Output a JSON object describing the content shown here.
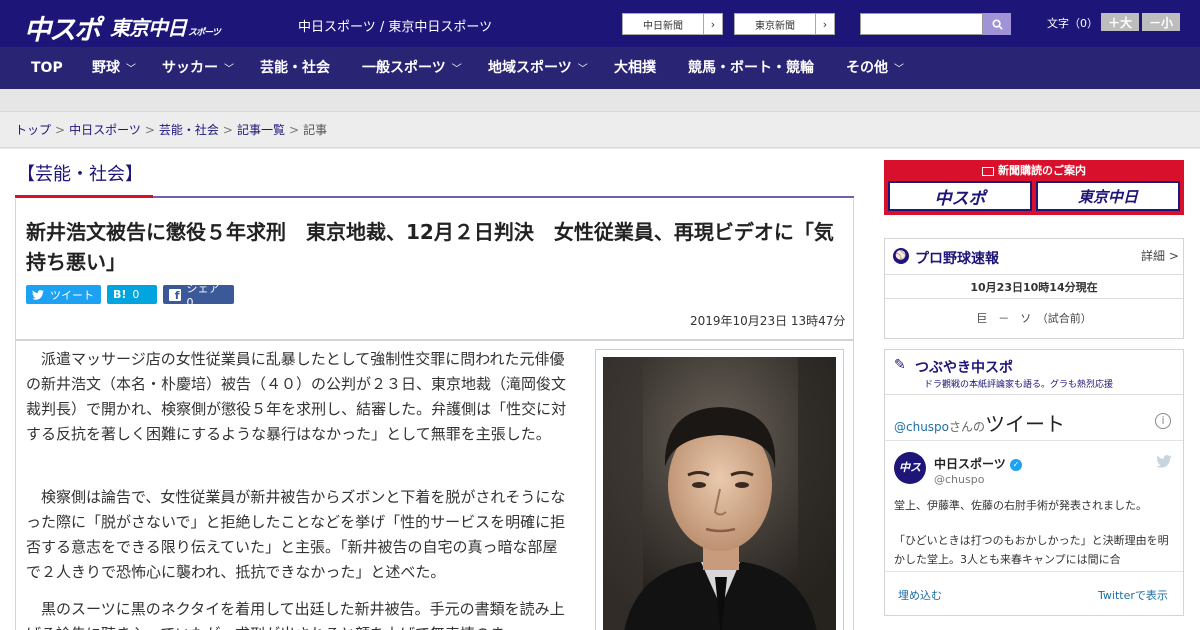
{
  "header": {
    "logo_main": "中スポ",
    "logo_tokyo": "東京中日",
    "logo_tokyo_sub": "スポーツ",
    "site_title": "中日スポーツ / 東京中日スポーツ",
    "link1": "中日新聞",
    "link2": "東京新聞",
    "font_label": "文字（0）",
    "font_bigger": "＋大",
    "font_smaller": "－小"
  },
  "nav": {
    "items": [
      "TOP",
      "野球",
      "サッカー",
      "芸能・社会",
      "一般スポーツ",
      "地域スポーツ",
      "大相撲",
      "競馬・ボート・競輪",
      "その他"
    ]
  },
  "breadcrumb": {
    "top": "トップ",
    "chunichi": "中日スポーツ",
    "category": "芸能・社会",
    "list": "記事一覧",
    "current": "記事",
    "sep": ">"
  },
  "article": {
    "category": "【芸能・社会】",
    "headline": "新井浩文被告に懲役５年求刑　東京地裁、12月２日判決　女性従業員、再現ビデオに「気持ち悪い」",
    "share_tweet": "ツイート",
    "share_hatena": "0",
    "share_facebook": "シェア 0",
    "date": "2019年10月23日 13時47分",
    "paragraphs": [
      "派遣マッサージ店の女性従業員に乱暴したとして強制性交罪に問われた元俳優の新井浩文（本名・朴慶培）被告（４０）の公判が２３日、東京地裁（滝岡俊文裁判長）で開かれ、検察側が懲役５年を求刑し、結審した。弁護側は「性交に対する反抗を著しく困難にするような暴行はなかった」として無罪を主張した。",
      "検察側は論告で、女性従業員が新井被告からズボンと下着を脱がされそうになった際に「脱がさないで」と拒絶したことなどを挙げ「性的サービスを明確に拒否する意志をできる限り伝えていた」と主張。「新井被告の自宅の真っ暗な部屋で２人きりで恐怖心に襲われ、抵抗できなかった」と述べた。",
      "黒のスーツに黒のネクタイを着用して出廷した新井被告。手元の書類を読み上げる論告に聴き入っていたが、求刑が出されると顔を上げて無表情のま"
    ]
  },
  "sidebar": {
    "ad_title": "新聞購読のご案内",
    "ad_left": "中スポ",
    "ad_right": "東京中日",
    "baseball_title": "プロ野球速報",
    "baseball_detail": "詳細 >",
    "baseball_time": "10月23日10時14分現在",
    "baseball_game": "巨　－　ソ　（試合前）",
    "tsubuyaki_title": "つぶやき中スポ",
    "tsubuyaki_sub": "ドラ觀戦の本紙評論家も語る。グラも熱烈応援",
    "tweets_handle": "@chuspo",
    "tweets_san": "さんの",
    "tweets_label": "ツイート",
    "account_name": "中日スポーツ",
    "account_handle": "@chuspo",
    "tweet_text_1": "堂上、伊藤準、佐藤の右肘手術が発表されました。",
    "tweet_text_2": "「ひどいときは打つのもおかしかった」と決断理由を明かした堂上。3人とも来春キャンプには間に合",
    "embed": "埋め込む",
    "view_on_twitter": "Twitterで表示"
  },
  "colors": {
    "header_bg": "#1d1678",
    "nav_bg": "#2a2475",
    "accent_red": "#d8102b",
    "twitter_blue": "#1da1f2",
    "hatena_blue": "#00a4de",
    "facebook_blue": "#3b5998"
  }
}
